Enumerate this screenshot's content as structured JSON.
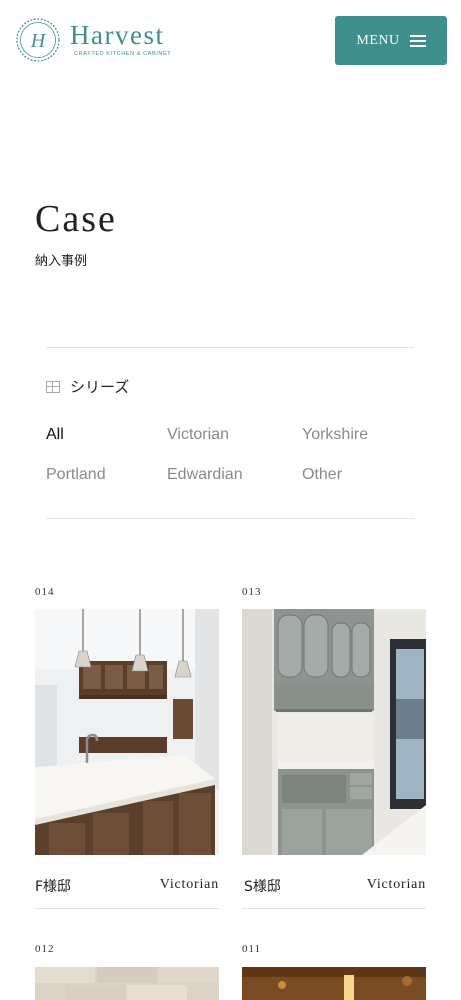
{
  "header": {
    "logo_name": "Harvest",
    "logo_sub": "CRAFTED KITCHEN & CABINET",
    "logo_monogram": "H",
    "menu_label": "MENU",
    "accent": "#3f8f8c"
  },
  "page": {
    "title": "Case",
    "subtitle": "納入事例"
  },
  "filter": {
    "heading": "シリーズ",
    "icon": "grid-icon",
    "options": [
      "All",
      "Victorian",
      "Yorkshire",
      "Portland",
      "Edwardian",
      "Other"
    ],
    "selected": "All"
  },
  "cases": [
    {
      "number": "014",
      "name": "F様邸",
      "series": "Victorian"
    },
    {
      "number": "013",
      "name": "S様邸",
      "series": "Victorian"
    },
    {
      "number": "012"
    },
    {
      "number": "011"
    }
  ]
}
